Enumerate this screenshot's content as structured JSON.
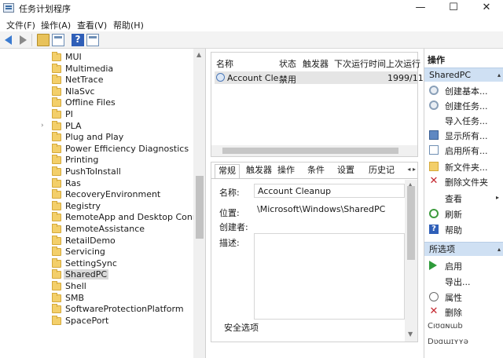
{
  "window": {
    "title": "任务计划程序",
    "minimize_glyph": "—",
    "maximize_glyph": "☐",
    "close_glyph": "✕"
  },
  "menubar": [
    "文件(F)",
    "操作(A)",
    "查看(V)",
    "帮助(H)"
  ],
  "toolbar": {
    "icons": [
      "back-arrow-icon",
      "forward-arrow-icon",
      "folder-up-icon",
      "show-panel-icon",
      "help-icon",
      "action-panel-icon"
    ],
    "help_glyph": "?"
  },
  "tree": {
    "items": [
      {
        "label": "MUI"
      },
      {
        "label": "Multimedia"
      },
      {
        "label": "NetTrace"
      },
      {
        "label": "NlaSvc"
      },
      {
        "label": "Offline Files"
      },
      {
        "label": "PI"
      },
      {
        "label": "PLA",
        "expandable": true
      },
      {
        "label": "Plug and Play"
      },
      {
        "label": "Power Efficiency Diagnostics"
      },
      {
        "label": "Printing"
      },
      {
        "label": "PushToInstall"
      },
      {
        "label": "Ras"
      },
      {
        "label": "RecoveryEnvironment"
      },
      {
        "label": "Registry"
      },
      {
        "label": "RemoteApp and Desktop Connection"
      },
      {
        "label": "RemoteAssistance"
      },
      {
        "label": "RetailDemo"
      },
      {
        "label": "Servicing"
      },
      {
        "label": "SettingSync"
      },
      {
        "label": "SharedPC",
        "selected": true
      },
      {
        "label": "Shell"
      },
      {
        "label": "SMB"
      },
      {
        "label": "SoftwareProtectionPlatform"
      },
      {
        "label": "SpacePort"
      }
    ],
    "expand_glyph": "›"
  },
  "task_list": {
    "columns": [
      "名称",
      "状态",
      "触发器",
      "下次运行时间",
      "上次运行"
    ],
    "rows": [
      {
        "name": "Account Cle...",
        "status": "禁用",
        "triggers": "",
        "next_run": "",
        "last_run": "1999/11"
      }
    ]
  },
  "details": {
    "tabs": [
      "常规",
      "触发器",
      "操作",
      "条件",
      "设置",
      "历史记"
    ],
    "tab_arrows": "◂ ▸",
    "fields": {
      "name_label": "名称:",
      "name_value": "Account Cleanup",
      "location_label": "位置:",
      "location_value": "\\Microsoft\\Windows\\SharedPC",
      "author_label": "创建者:",
      "description_label": "描述:",
      "security_label": "安全选项"
    }
  },
  "actions": {
    "header": "操作",
    "section_folder": "SharedPC",
    "folder_items": [
      {
        "label": "创建基本...",
        "icon": "gear-icon"
      },
      {
        "label": "创建任务...",
        "icon": "gear-icon"
      },
      {
        "label": "导入任务...",
        "icon": "import-icon"
      },
      {
        "label": "显示所有...",
        "icon": "monitor-icon"
      },
      {
        "label": "启用所有...",
        "icon": "enable-all-icon"
      },
      {
        "label": "新文件夹...",
        "icon": "folder-icon"
      },
      {
        "label": "删除文件夹",
        "icon": "delete-icon"
      },
      {
        "label": "查看",
        "icon": "",
        "submenu": true
      },
      {
        "label": "刷新",
        "icon": "refresh-icon"
      },
      {
        "label": "帮助",
        "icon": "help-icon"
      }
    ],
    "section_selected": "所选项",
    "selected_items": [
      {
        "label": "启用",
        "icon": "run-icon"
      },
      {
        "label": "导出...",
        "icon": ""
      },
      {
        "label": "属性",
        "icon": "clock-icon"
      },
      {
        "label": "删除",
        "icon": "delete-icon"
      }
    ],
    "caret_glyph": "▴",
    "submenu_glyph": "▸",
    "x_glyph": "✕",
    "help_glyph": "?"
  },
  "bottom_fragments": [
    "Ⅽıʊɑɴɯb",
    "Ⅾʋɑɯɪʏʏə"
  ]
}
